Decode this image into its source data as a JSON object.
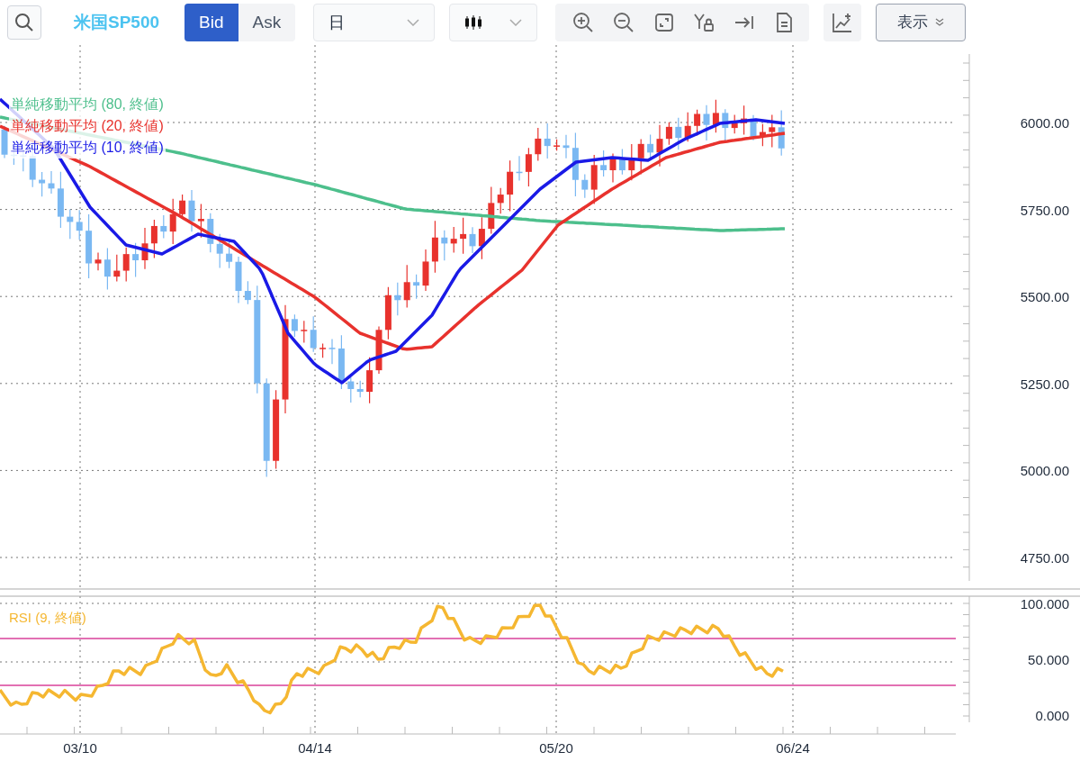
{
  "toolbar": {
    "symbol": "米国SP500",
    "price_tabs": [
      {
        "label": "Bid",
        "selected": true
      },
      {
        "label": "Ask",
        "selected": false
      }
    ],
    "period": "日",
    "display_button": "表示"
  },
  "main_chart": {
    "legend": [
      {
        "label": "単純移動平均 (80, 終値)",
        "color": "#4dbf8c"
      },
      {
        "label": "単純移動平均 (20, 終値)",
        "color": "#e8322d"
      },
      {
        "label": "単純移動平均 (10, 終値)",
        "color": "#1a1ae6"
      }
    ],
    "price_ticks": [
      "6000.00",
      "5750.00",
      "5500.00",
      "5250.00",
      "5000.00",
      "4750.00"
    ]
  },
  "rsi_panel": {
    "legend": "RSI (9, 終値)",
    "ticks": [
      "100.000",
      "50.000",
      "0.000"
    ]
  },
  "date_labels": [
    "03/10",
    "04/14",
    "05/20",
    "06/24"
  ]
}
